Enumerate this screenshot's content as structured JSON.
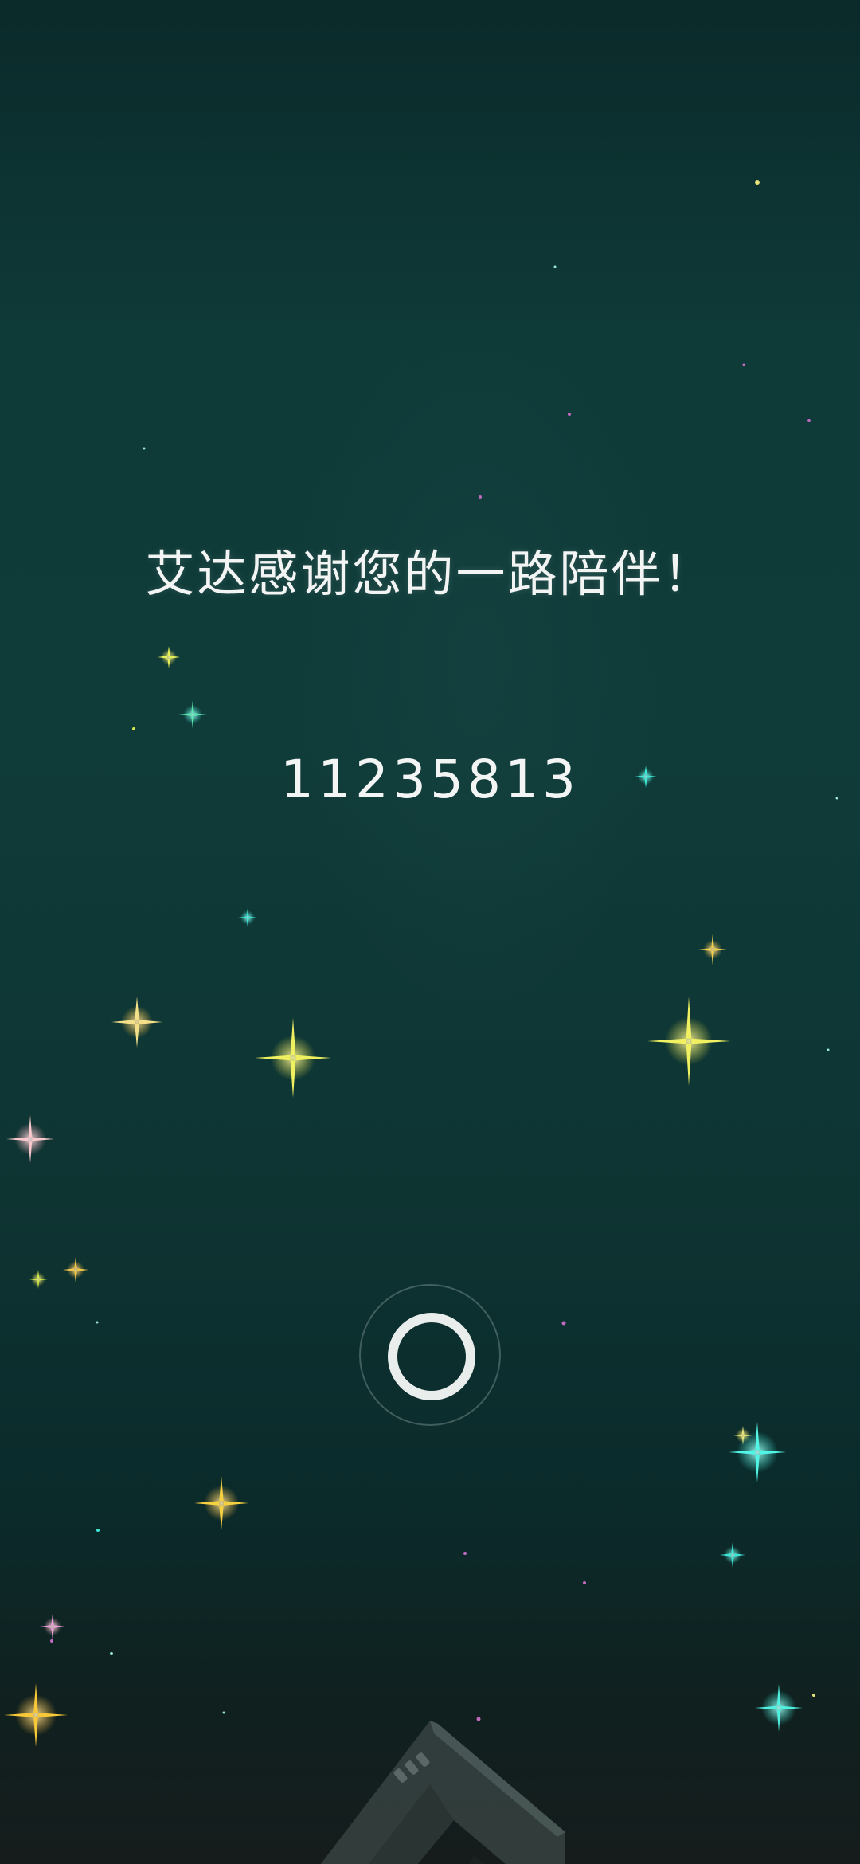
{
  "screen": {
    "message": "艾达感谢您的一路陪伴！",
    "code": "11235813",
    "loading": true
  },
  "stars": [
    {
      "color": "#e6e37a",
      "size": "tiny"
    },
    {
      "color": "#9be8d8",
      "size": "tiny"
    },
    {
      "color": "#c06ac0",
      "size": "tiny"
    },
    {
      "color": "#cfe84a",
      "size": "small"
    },
    {
      "color": "#5be6b0",
      "size": "small"
    },
    {
      "color": "#3ee6d6",
      "size": "small"
    },
    {
      "color": "#f0c64a",
      "size": "medium"
    },
    {
      "color": "#e6f05a",
      "size": "large"
    },
    {
      "color": "#f0f08a",
      "size": "large"
    },
    {
      "color": "#f0b0b8",
      "size": "medium"
    },
    {
      "color": "#40f0e0",
      "size": "large"
    },
    {
      "color": "#f5c030",
      "size": "large"
    }
  ]
}
